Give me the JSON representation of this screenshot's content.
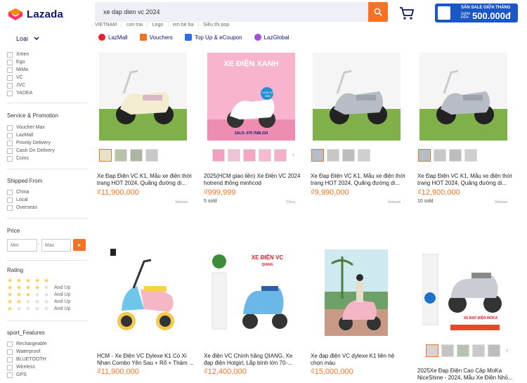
{
  "header": {
    "logo_text": "Lazada",
    "search_value": "xe dap dien vc 2024",
    "promo": {
      "line1": "SĂN SALE GIỮA THÁNG",
      "line2a": "GIẢM",
      "line2b": "ĐẾN",
      "amount": "500.000đ"
    }
  },
  "suggestions": [
    "VIETNAM",
    "con trai",
    "Lego",
    "em bé ba",
    "Siêu thị pop"
  ],
  "nav": [
    {
      "label": "LazMall",
      "color": "#e5232d"
    },
    {
      "label": "Vouchers",
      "color": "#f57224"
    },
    {
      "label": "Top Up & eCoupon",
      "color": "#2a6fe0"
    },
    {
      "label": "LazGlobal",
      "color": "#a34ed9"
    }
  ],
  "sidebar": {
    "loai_label": "Loại",
    "brands": [
      "Xmen",
      "Ego",
      "MiMa",
      "VC",
      "JVC",
      "YADEA"
    ],
    "service_title": "Service & Promotion",
    "service": [
      "Voucher Max",
      "LazMall",
      "Priority Delivery",
      "Cash On Delivery",
      "Coins"
    ],
    "shipped_title": "Shipped From",
    "shipped": [
      "China",
      "Local",
      "Overseas"
    ],
    "price_title": "Price",
    "min_placeholder": "Min",
    "max_placeholder": "Max",
    "price_sep": "-",
    "price_go": "▸",
    "rating_title": "Rating",
    "rating_suffix": "And Up",
    "features_title": "sport_Features",
    "features": [
      "Rechargeable",
      "Waterproof",
      "BLUETOOTH",
      "Wireless",
      "GPS"
    ]
  },
  "products": [
    {
      "title": "Xe Đạp Điện VC K1, Mẫu xe điện thời trang HOT 2024, Quãng đường di...",
      "price": "₫11,900,000",
      "sold": "",
      "location": "Vietnam"
    },
    {
      "title": "2025(HCM giao liền) Xe Điện VC 2024 hotrend thông minhcod",
      "price": "₫999,999",
      "sold": "5 sold",
      "location": "China",
      "banner1": "XE ĐIỆN XANH",
      "banner2": "HCM CÓ SẴN",
      "banner3": "ZALO: 079 7588 234"
    },
    {
      "title": "Xe Đạp Điện VC K1, Mẫu xe điện thời trang HOT 2024, Quãng đường di...",
      "price": "₫9,990,000",
      "sold": "",
      "location": "Vietnam"
    },
    {
      "title": "Xe Đạp Điện VC K1, Mẫu xe điện thời trang HOT 2024, Quãng đường di...",
      "price": "₫12,900,000",
      "sold": "10 sold",
      "location": "Vietnam"
    },
    {
      "title": "HCM - Xe Điện VC Dylexe K1 Có Xi Nhan Combo Yên Sau + Rổ + Thảm ...",
      "price": "₫11,900,000",
      "sold": "",
      "location": ""
    },
    {
      "title": "Xe điện VC Chính hãng QIANG, Xe đạp điện Hotgirl, Lắp bình lớn 70-...",
      "price": "₫12,400,000",
      "sold": "",
      "location": "",
      "banner1": "XE ĐIỆN VC",
      "banner2": "QIANG"
    },
    {
      "title": "Xe đạp điện VC dylexe K1 liên hệ chọn màu",
      "price": "₫15,000,000",
      "sold": "",
      "location": ""
    },
    {
      "title": "2025Xe Đạp Điện Cao Cấp MoKa NiceShine - 2024, Mẫu Xe Điện Nhỏ...",
      "price": "₫11,900,000",
      "sold": "",
      "location": "",
      "banner1": "XE ĐẠP ĐIỆN MOKA"
    }
  ]
}
